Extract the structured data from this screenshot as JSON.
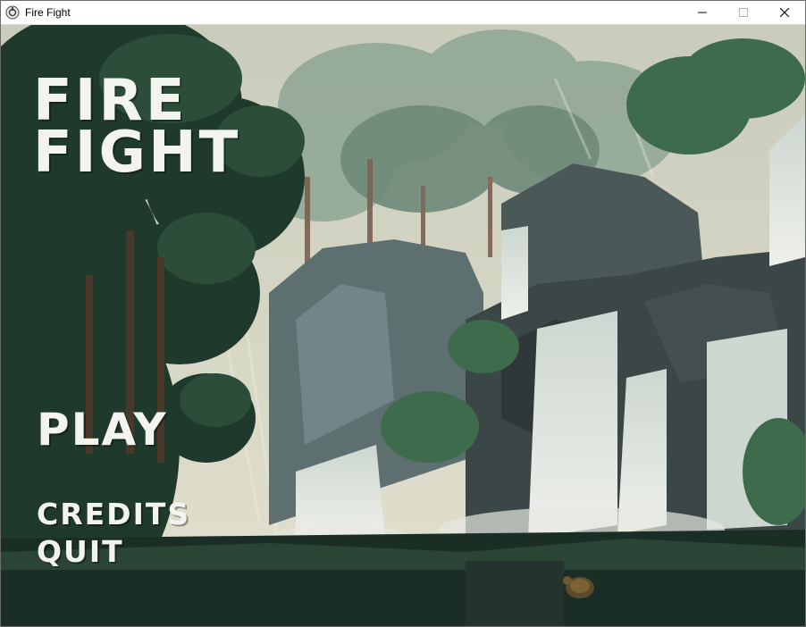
{
  "window": {
    "title": "Fire Fight",
    "icon": "gamemaker-app-icon",
    "controls": [
      "minimize-icon",
      "maximize-icon",
      "close-icon"
    ]
  },
  "game": {
    "title_line1": "FIRE",
    "title_line2": "FIGHT",
    "background": "pixel-art forest waterfall",
    "menu": {
      "play": "PLAY",
      "credits": "CREDITS",
      "quit": "QUIT"
    }
  },
  "colors": {
    "menu_text": "#f3f3f0",
    "sky": "#d6d6c6",
    "foliage_dark": "#1f3a2c",
    "rock": "#3f4b4b"
  }
}
